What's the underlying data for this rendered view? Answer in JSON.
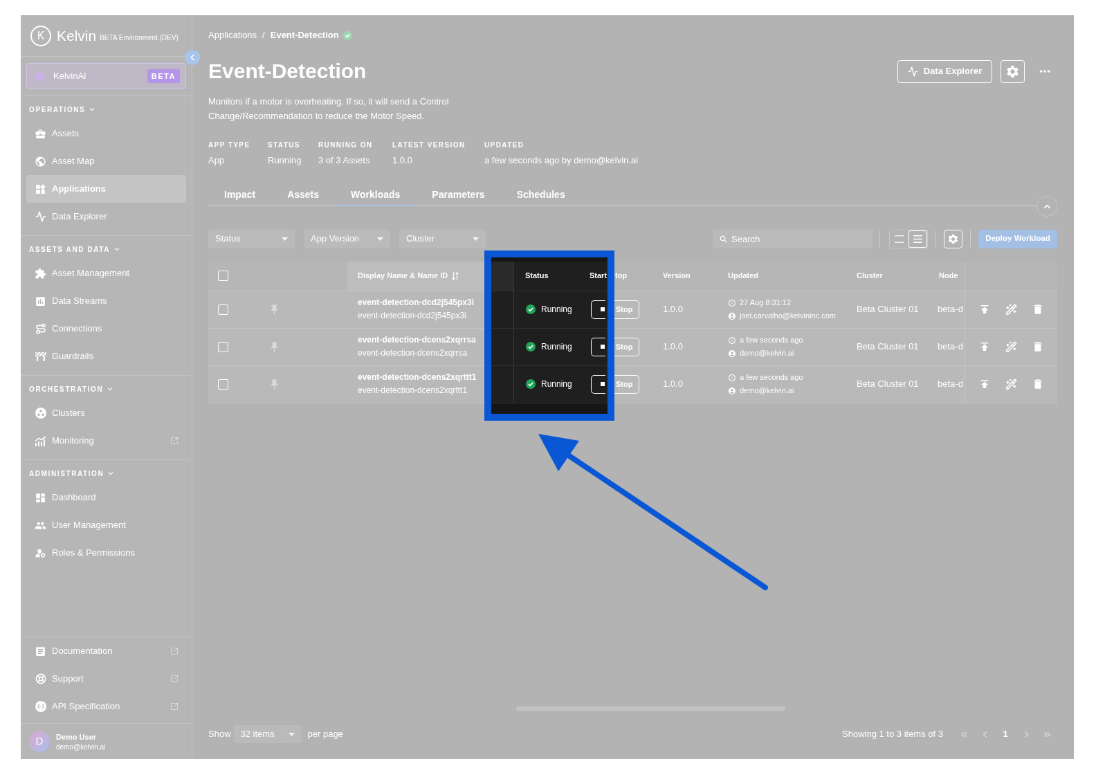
{
  "sidebar": {
    "logo": {
      "mark": "K",
      "name": "Kelvin",
      "environment": "BETA Environment (DEV)"
    },
    "ai_button": {
      "label": "KelvinAI",
      "badge": "BETA"
    },
    "sections": [
      {
        "title": "OPERATIONS",
        "expanded": true,
        "items": [
          {
            "label": "Assets",
            "selected": false,
            "external": false
          },
          {
            "label": "Asset Map",
            "selected": false,
            "external": false
          },
          {
            "label": "Applications",
            "selected": true,
            "external": false
          },
          {
            "label": "Data Explorer",
            "selected": false,
            "external": false
          }
        ]
      },
      {
        "title": "ASSETS AND DATA",
        "expanded": true,
        "items": [
          {
            "label": "Asset Management",
            "selected": false,
            "external": false
          },
          {
            "label": "Data Streams",
            "selected": false,
            "external": false
          },
          {
            "label": "Connections",
            "selected": false,
            "external": false
          },
          {
            "label": "Guardrails",
            "selected": false,
            "external": false
          }
        ]
      },
      {
        "title": "ORCHESTRATION",
        "expanded": true,
        "items": [
          {
            "label": "Clusters",
            "selected": false,
            "external": false
          },
          {
            "label": "Monitoring",
            "selected": false,
            "external": true
          }
        ]
      },
      {
        "title": "ADMINISTRATION",
        "expanded": true,
        "items": [
          {
            "label": "Dashboard",
            "selected": false,
            "external": false
          },
          {
            "label": "User Management",
            "selected": false,
            "external": false
          },
          {
            "label": "Roles & Permissions",
            "selected": false,
            "external": false
          }
        ]
      }
    ],
    "links": [
      {
        "label": "Documentation",
        "external": true
      },
      {
        "label": "Support",
        "external": true
      },
      {
        "label": "API Specification",
        "external": true
      }
    ],
    "user": {
      "initial": "D",
      "name": "Demo User",
      "email": "demo@kelvin.ai"
    }
  },
  "breadcrumb": {
    "items": [
      {
        "label": "Applications",
        "current": false
      },
      {
        "label": "Event-Detection",
        "current": true
      }
    ],
    "separator": "/"
  },
  "title": "Event-Detection",
  "header_actions": {
    "data_explorer": "Data Explorer"
  },
  "description": "Monitors if a motor is overheating. If so, it will send a Control Change/Recommendation to reduce the Motor Speed.",
  "summary": [
    {
      "label": "APP TYPE",
      "value": "App"
    },
    {
      "label": "STATUS",
      "value": "Running"
    },
    {
      "label": "RUNNING ON",
      "value": "3 of 3 Assets"
    },
    {
      "label": "LATEST VERSION",
      "value": "1.0.0"
    },
    {
      "label": "UPDATED",
      "value": "a few seconds ago by demo@kelvin.ai"
    }
  ],
  "tabs": [
    {
      "label": "Impact",
      "selected": false
    },
    {
      "label": "Assets",
      "selected": false
    },
    {
      "label": "Workloads",
      "selected": true
    },
    {
      "label": "Parameters",
      "selected": false
    },
    {
      "label": "Schedules",
      "selected": false
    }
  ],
  "toolbar": {
    "filters": [
      {
        "label": "Status"
      },
      {
        "label": "App Version"
      },
      {
        "label": "Cluster"
      }
    ],
    "search": {
      "placeholder": "Search"
    },
    "view_modes": [
      {
        "selected": false
      },
      {
        "selected": true
      }
    ],
    "deploy_button": "Deploy Workload"
  },
  "table": {
    "select_all": {
      "checked": false
    },
    "columns": [
      {
        "label": "Display Name & Name ID",
        "sorted": true
      },
      {
        "label": "Status"
      },
      {
        "label": "Start",
        "label_beyond_frame": "top"
      },
      {
        "label": "Version"
      },
      {
        "label": "Updated"
      },
      {
        "label": "Cluster"
      },
      {
        "label": "Node"
      }
    ],
    "rows": [
      {
        "checked": false,
        "pinned": false,
        "display_name": "event-detection-dcd2j545px3i",
        "name_id": "event-detection-dcd2j545px3i",
        "status": {
          "kind": "running",
          "label": "Running"
        },
        "action": "Stop",
        "version": "1.0.0",
        "updated": {
          "time": "27 Aug 8:31:12",
          "user": "joel.carvalho@kelvininc.com"
        },
        "cluster": "Beta Cluster 01",
        "node": "beta-d"
      },
      {
        "checked": false,
        "pinned": false,
        "display_name": "event-detection-dcens2xqrrsa",
        "name_id": "event-detection-dcens2xqrrsa",
        "status": {
          "kind": "running",
          "label": "Running"
        },
        "action": "Stop",
        "version": "1.0.0",
        "updated": {
          "time": "a few seconds ago",
          "user": "demo@kelvin.ai"
        },
        "cluster": "Beta Cluster 01",
        "node": "beta-d"
      },
      {
        "checked": false,
        "pinned": false,
        "display_name": "event-detection-dcens2xqrttt1",
        "name_id": "event-detection-dcens2xqrttt1",
        "status": {
          "kind": "running",
          "label": "Running"
        },
        "action": "Stop",
        "version": "1.0.0",
        "updated": {
          "time": "a few seconds ago",
          "user": "demo@kelvin.ai"
        },
        "cluster": "Beta Cluster 01",
        "node": "beta-d"
      }
    ]
  },
  "footer": {
    "show_label": "Show",
    "page_size": "32 items",
    "per_page_label": "per page",
    "summary": "Showing 1 to 3 items of 3",
    "pages": [
      {
        "label": "1",
        "selected": true
      }
    ]
  }
}
